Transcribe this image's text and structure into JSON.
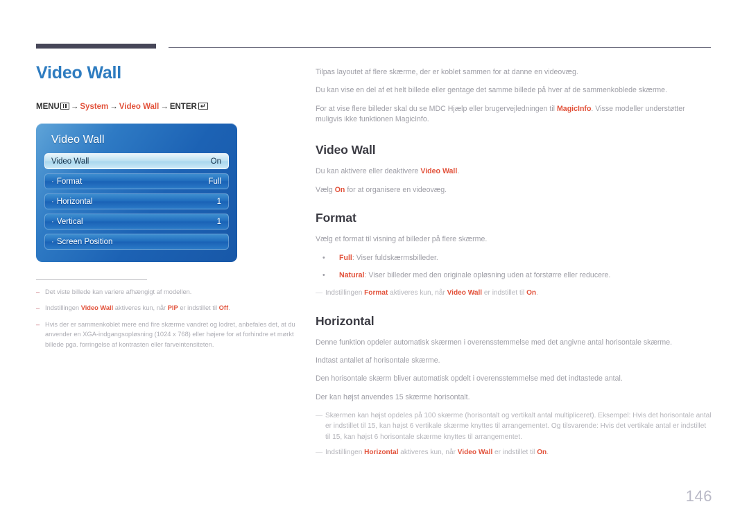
{
  "header": {
    "rule_color": "#464658"
  },
  "left": {
    "title": "Video Wall",
    "menu_path": {
      "menu_label": "MENU",
      "menu_icon": "menu-bars-icon",
      "arrow": "→",
      "step1": "System",
      "step2": "Video Wall",
      "enter_label": "ENTER",
      "enter_icon": "enter-return-icon",
      "enter_glyph": "↵"
    },
    "osd": {
      "title": "Video Wall",
      "rows": [
        {
          "label": "Video Wall",
          "value": "On",
          "selected": true,
          "bullet": ""
        },
        {
          "label": "Format",
          "value": "Full",
          "selected": false,
          "bullet": "·"
        },
        {
          "label": "Horizontal",
          "value": "1",
          "selected": false,
          "bullet": "·"
        },
        {
          "label": "Vertical",
          "value": "1",
          "selected": false,
          "bullet": "·"
        },
        {
          "label": "Screen Position",
          "value": "",
          "selected": false,
          "bullet": "·"
        }
      ]
    },
    "notes": [
      {
        "dash": "–",
        "parts": [
          {
            "t": "Det viste billede kan variere afhængigt af modellen.",
            "b": false
          }
        ]
      },
      {
        "dash": "–",
        "parts": [
          {
            "t": "Indstillingen ",
            "b": false
          },
          {
            "t": "Video Wall",
            "b": true
          },
          {
            "t": " aktiveres kun, når ",
            "b": false
          },
          {
            "t": "PIP",
            "b": true
          },
          {
            "t": " er indstillet til ",
            "b": false
          },
          {
            "t": "Off",
            "b": true
          },
          {
            "t": ".",
            "b": false
          }
        ]
      },
      {
        "dash": "–",
        "parts": [
          {
            "t": "Hvis der er sammenkoblet mere end fire skærme vandret og lodret, anbefales det, at du anvender en XGA-indgangsopløsning (1024 x 768) eller højere for at forhindre et mørkt billede pga. forringelse af kontrasten eller farveintensiteten.",
            "b": false
          }
        ]
      }
    ]
  },
  "right": {
    "intro": [
      [
        {
          "t": "Tilpas layoutet af flere skærme, der er koblet sammen for at danne en videovæg.",
          "b": false
        }
      ],
      [
        {
          "t": "Du kan vise en del af et helt billede eller gentage det samme billede på hver af de sammenkoblede skærme.",
          "b": false
        }
      ],
      [
        {
          "t": "For at vise flere billeder skal du se MDC Hjælp eller brugervejledningen til ",
          "b": false
        },
        {
          "t": "MagicInfo",
          "b": true
        },
        {
          "t": ". Visse modeller understøtter muligvis ikke funktionen MagicInfo.",
          "b": false
        }
      ]
    ],
    "sections": [
      {
        "heading": "Video Wall",
        "paragraphs": [
          [
            {
              "t": "Du kan aktivere eller deaktivere ",
              "b": false
            },
            {
              "t": "Video Wall",
              "b": true
            },
            {
              "t": ".",
              "b": false
            }
          ],
          [
            {
              "t": "Vælg ",
              "b": false
            },
            {
              "t": "On",
              "b": true
            },
            {
              "t": " for at organisere en videovæg.",
              "b": false
            }
          ]
        ],
        "bullets": [],
        "notes": []
      },
      {
        "heading": "Format",
        "paragraphs": [
          [
            {
              "t": "Vælg et format til visning af billeder på flere skærme.",
              "b": false
            }
          ]
        ],
        "bullets": [
          {
            "dot": "•",
            "parts": [
              {
                "t": "Full",
                "b": true
              },
              {
                "t": ": Viser fuldskærmsbilleder.",
                "b": false
              }
            ]
          },
          {
            "dot": "•",
            "parts": [
              {
                "t": "Natural",
                "b": true
              },
              {
                "t": ": Viser billeder med den originale opløsning uden at forstørre eller reducere.",
                "b": false
              }
            ]
          }
        ],
        "notes": [
          {
            "dash": "—",
            "parts": [
              {
                "t": "Indstillingen ",
                "b": false
              },
              {
                "t": "Format",
                "b": true
              },
              {
                "t": " aktiveres kun, når ",
                "b": false
              },
              {
                "t": "Video Wall",
                "b": true
              },
              {
                "t": " er indstillet til ",
                "b": false
              },
              {
                "t": "On",
                "b": true
              },
              {
                "t": ".",
                "b": false
              }
            ]
          }
        ]
      },
      {
        "heading": "Horizontal",
        "paragraphs": [
          [
            {
              "t": "Denne funktion opdeler automatisk skærmen i overensstemmelse med det angivne antal horisontale skærme.",
              "b": false
            }
          ],
          [
            {
              "t": "Indtast antallet af horisontale skærme.",
              "b": false
            }
          ],
          [
            {
              "t": "Den horisontale skærm bliver automatisk opdelt i overensstemmelse med det indtastede antal.",
              "b": false
            }
          ],
          [
            {
              "t": "Der kan højst anvendes 15 skærme horisontalt.",
              "b": false
            }
          ]
        ],
        "bullets": [],
        "notes": [
          {
            "dash": "—",
            "parts": [
              {
                "t": "Skærmen kan højst opdeles på 100 skærme (horisontalt og vertikalt antal multipliceret). Eksempel: Hvis det horisontale antal er indstillet til 15, kan højst 6 vertikale skærme knyttes til arrangementet. Og tilsvarende: Hvis det vertikale antal er indstillet til 15, kan højst 6 horisontale skærme knyttes til arrangementet.",
                "b": false
              }
            ]
          },
          {
            "dash": "—",
            "parts": [
              {
                "t": "Indstillingen ",
                "b": false
              },
              {
                "t": "Horizontal",
                "b": true
              },
              {
                "t": " aktiveres kun, når ",
                "b": false
              },
              {
                "t": "Video Wall",
                "b": true
              },
              {
                "t": " er indstillet til ",
                "b": false
              },
              {
                "t": "On",
                "b": true
              },
              {
                "t": ".",
                "b": false
              }
            ]
          }
        ]
      }
    ]
  },
  "page_number": "146"
}
